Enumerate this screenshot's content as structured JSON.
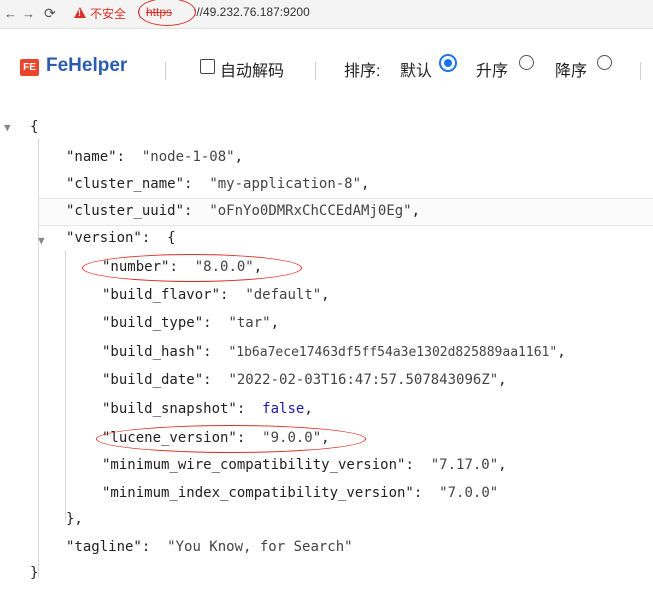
{
  "address_bar": {
    "back_icon": "arrow-left",
    "forward_icon": "arrow-right",
    "reload_icon": "reload",
    "insecure_label": "不安全",
    "scheme": "https",
    "host": "://49.232.76.187:9200"
  },
  "toolbar": {
    "logo_badge": "FE",
    "brand": "FeHelper",
    "auto_decode_label": "自动解码",
    "sort_label": "排序:",
    "sort_default": "默认",
    "sort_asc": "升序",
    "sort_desc": "降序",
    "sort_selected": "默认"
  },
  "json": {
    "open_brace": "{",
    "close_brace": "}",
    "name_key": "\"name\"",
    "name_val": "\"node-1-08\"",
    "cluster_name_key": "\"cluster_name\"",
    "cluster_name_val": "\"my-application-8\"",
    "cluster_uuid_key": "\"cluster_uuid\"",
    "cluster_uuid_val": "\"oFnYo0DMRxChCCEdAMj0Eg\"",
    "version_key": "\"version\"",
    "version_open": "{",
    "number_key": "\"number\"",
    "number_val": "\"8.0.0\"",
    "build_flavor_key": "\"build_flavor\"",
    "build_flavor_val": "\"default\"",
    "build_type_key": "\"build_type\"",
    "build_type_val": "\"tar\"",
    "build_hash_key": "\"build_hash\"",
    "build_hash_val": "\"1b6a7ece17463df5ff54a3e1302d825889aa1161\"",
    "build_date_key": "\"build_date\"",
    "build_date_val": "\"2022-02-03T16:47:57.507843096Z\"",
    "build_snapshot_key": "\"build_snapshot\"",
    "build_snapshot_val": "false",
    "lucene_version_key": "\"lucene_version\"",
    "lucene_version_val": "\"9.0.0\"",
    "min_wire_key": "\"minimum_wire_compatibility_version\"",
    "min_wire_val": "\"7.17.0\"",
    "min_index_key": "\"minimum_index_compatibility_version\"",
    "min_index_val": "\"7.0.0\"",
    "version_close": "},",
    "tagline_key": "\"tagline\"",
    "tagline_val": "\"You Know, for Search\""
  }
}
